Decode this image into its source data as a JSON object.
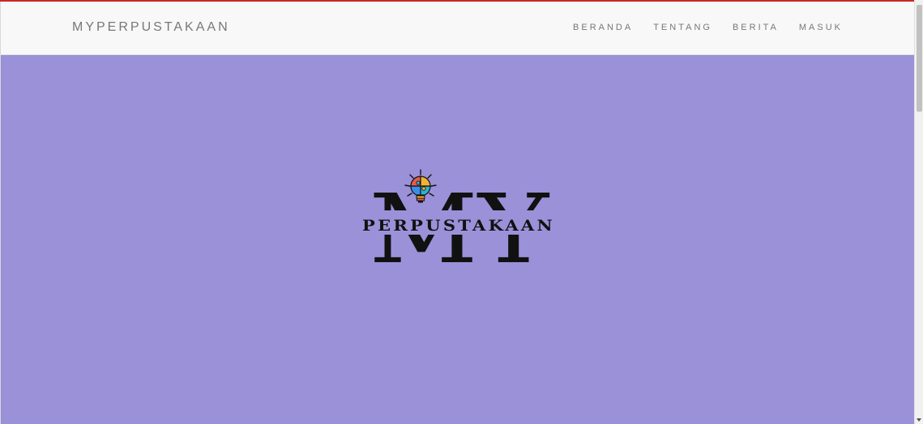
{
  "navbar": {
    "brand": "MYPERPUSTAKAAN",
    "links": [
      "BERANDA",
      "TENTANG",
      "BERITA",
      "MASUK"
    ]
  },
  "hero": {
    "logo": {
      "big_text": "MY",
      "small_text": "PERPUSTAKAAN",
      "icon": "lightbulb-puzzle-icon"
    }
  },
  "colors": {
    "hero_background": "#9b91d9",
    "navbar_background": "#f8f8f8",
    "nav_text": "#777777",
    "top_accent": "#c62828",
    "logo_text": "#111111"
  }
}
